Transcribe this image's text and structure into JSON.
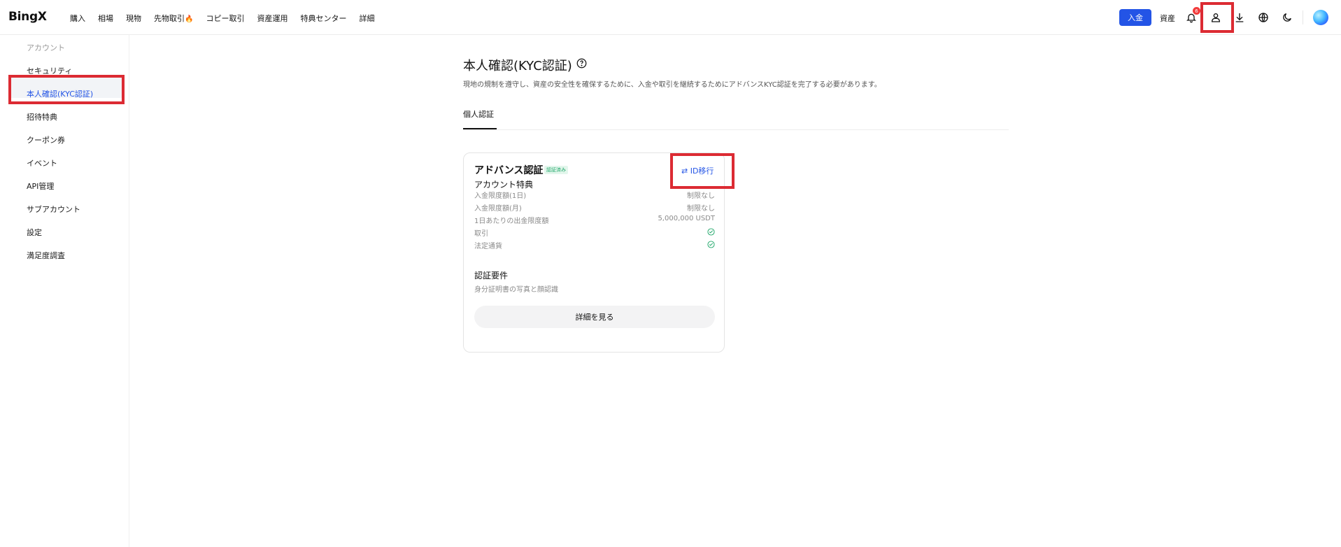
{
  "header": {
    "logo": "BingX",
    "nav": [
      {
        "label": "購入"
      },
      {
        "label": "相場"
      },
      {
        "label": "現物"
      },
      {
        "label": "先物取引"
      },
      {
        "label": "コピー取引"
      },
      {
        "label": "資産運用"
      },
      {
        "label": "特典センター"
      },
      {
        "label": "詳細"
      }
    ],
    "deposit": "入金",
    "assets": "資産",
    "notification_count": "6",
    "icons": [
      "bell-icon",
      "user-icon",
      "download-icon",
      "globe-icon",
      "moon-icon"
    ]
  },
  "sidebar": {
    "section": "アカウント",
    "items": [
      {
        "label": "セキュリティ"
      },
      {
        "label": "本人確認(KYC認証)"
      },
      {
        "label": "招待特典"
      },
      {
        "label": "クーポン券"
      },
      {
        "label": "イベント"
      },
      {
        "label": "API管理"
      },
      {
        "label": "サブアカウント"
      },
      {
        "label": "設定"
      },
      {
        "label": "満足度調査"
      }
    ],
    "active_index": 1
  },
  "main": {
    "title": "本人確認(KYC認証)",
    "description": "現地の規制を遵守し、資産の安全性を確保するために、入金や取引を継続するためにアドバンスKYC認証を完了する必要があります。",
    "tabs": [
      {
        "label": "個人認証"
      }
    ],
    "card": {
      "title": "アドバンス認証",
      "status": "認証済み",
      "id_transfer": "ID移行",
      "benefits_title": "アカウント特典",
      "benefits": [
        {
          "label": "入金限度額(1日)",
          "value": "制限なし"
        },
        {
          "label": "入金限度額(月)",
          "value": "制限なし"
        },
        {
          "label": "1日あたりの出金限度額",
          "value": "5,000,000 USDT"
        },
        {
          "label": "取引",
          "value": "check"
        },
        {
          "label": "法定通貨",
          "value": "check"
        }
      ],
      "requirements_title": "認証要件",
      "requirements": "身分証明書の写真と顔認識",
      "details_button": "詳細を見る"
    }
  },
  "colors": {
    "accent": "#2354e6",
    "highlight": "#dc2b33",
    "verified": "#1aa566"
  }
}
